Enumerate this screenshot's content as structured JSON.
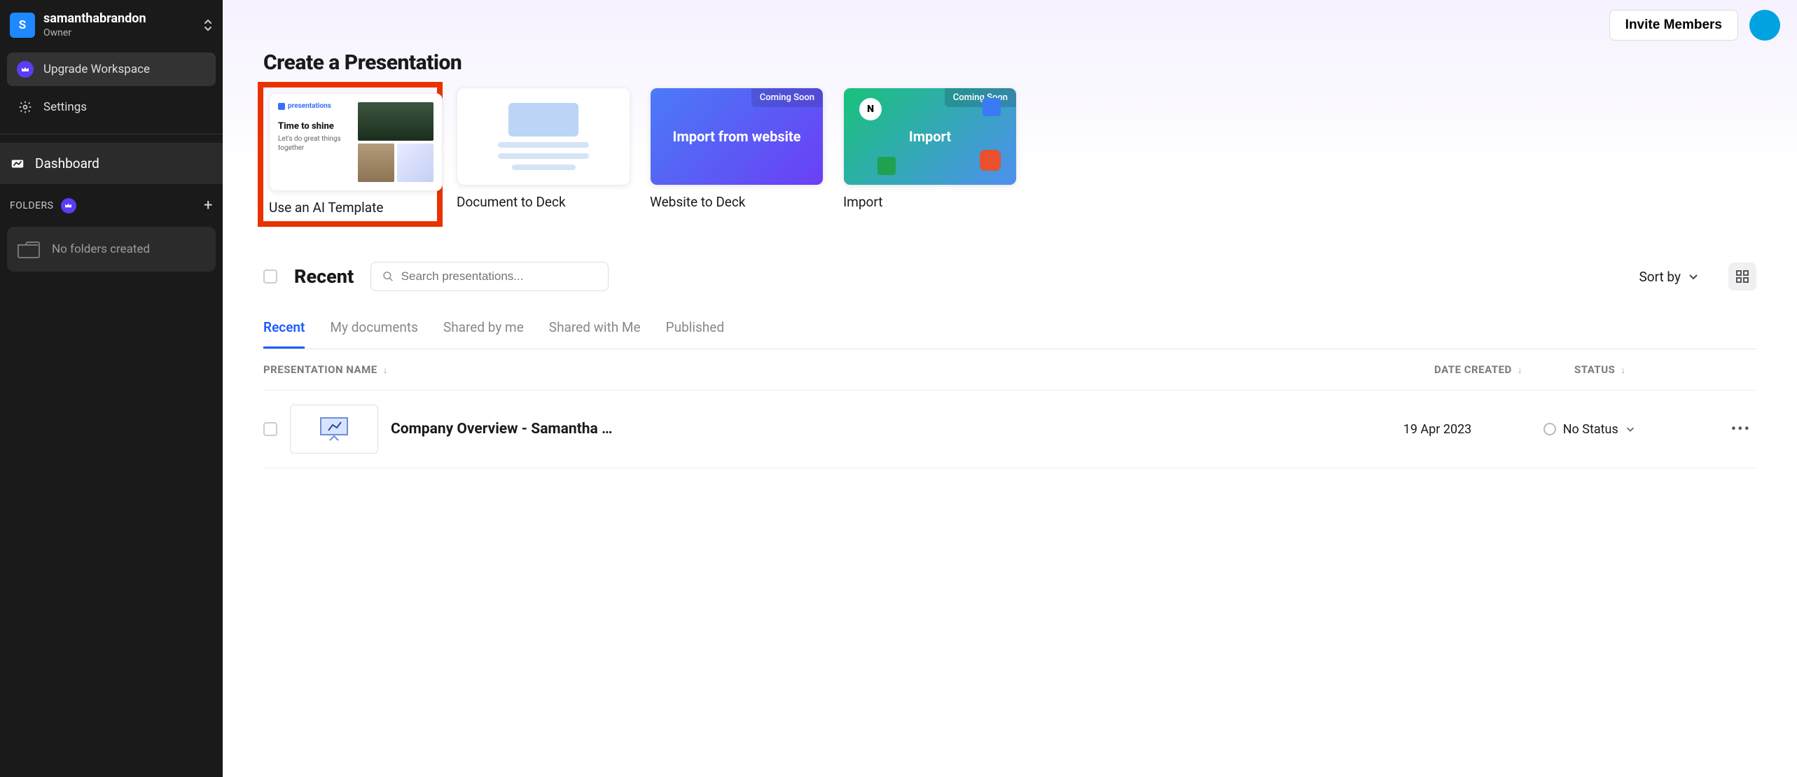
{
  "sidebar": {
    "workspace": {
      "initial": "S",
      "name": "samanthabrandon",
      "role": "Owner"
    },
    "upgrade_label": "Upgrade Workspace",
    "settings_label": "Settings",
    "dashboard_label": "Dashboard",
    "folders_label": "FOLDERS",
    "folders_empty": "No folders created"
  },
  "topbar": {
    "invite_label": "Invite Members"
  },
  "create": {
    "title": "Create a Presentation",
    "cards": [
      {
        "label": "Use an AI Template",
        "template_logo": "presentations",
        "template_title": "Time to shine",
        "template_sub": "Let's do great things together"
      },
      {
        "label": "Document to Deck"
      },
      {
        "label": "Website to Deck",
        "overlay_text": "Import from website",
        "badge": "Coming Soon"
      },
      {
        "label": "Import",
        "overlay_text": "Import",
        "badge": "Coming Soon"
      }
    ]
  },
  "recent": {
    "title": "Recent",
    "search_placeholder": "Search presentations...",
    "sortby_label": "Sort by",
    "tabs": [
      "Recent",
      "My documents",
      "Shared by me",
      "Shared with Me",
      "Published"
    ],
    "columns": {
      "name": "PRESENTATION NAME",
      "date": "DATE CREATED",
      "status": "STATUS"
    },
    "rows": [
      {
        "title": "Company Overview - Samantha …",
        "date": "19 Apr 2023",
        "status": "No Status"
      }
    ]
  }
}
